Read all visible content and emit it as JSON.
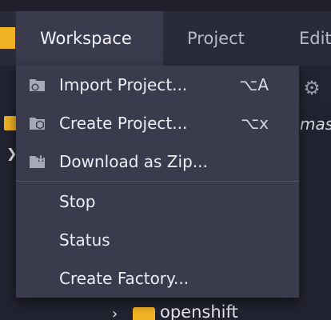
{
  "menubar": {
    "tabs": [
      {
        "label": "Workspace",
        "active": true
      },
      {
        "label": "Project",
        "active": false
      },
      {
        "label": "Edit",
        "active": false
      }
    ]
  },
  "background": {
    "peek_text": "mas",
    "tree_folder_label": "openshift"
  },
  "workspace_menu": {
    "items": [
      {
        "label": "Import Project...",
        "shortcut": "⌥A",
        "icon": "import-project-icon"
      },
      {
        "label": "Create Project...",
        "shortcut": "⌥x",
        "icon": "create-project-icon"
      },
      {
        "label": "Download as Zip...",
        "shortcut": "",
        "icon": "download-zip-icon"
      },
      {
        "label": "Stop",
        "shortcut": ""
      },
      {
        "label": "Status",
        "shortcut": ""
      },
      {
        "label": "Create Factory...",
        "shortcut": ""
      }
    ]
  },
  "colors": {
    "accent_folder": "#f0b323",
    "menu_bg": "#3a3c4e",
    "menubar_bg": "#2a2b39",
    "editor_bg": "#222330"
  }
}
